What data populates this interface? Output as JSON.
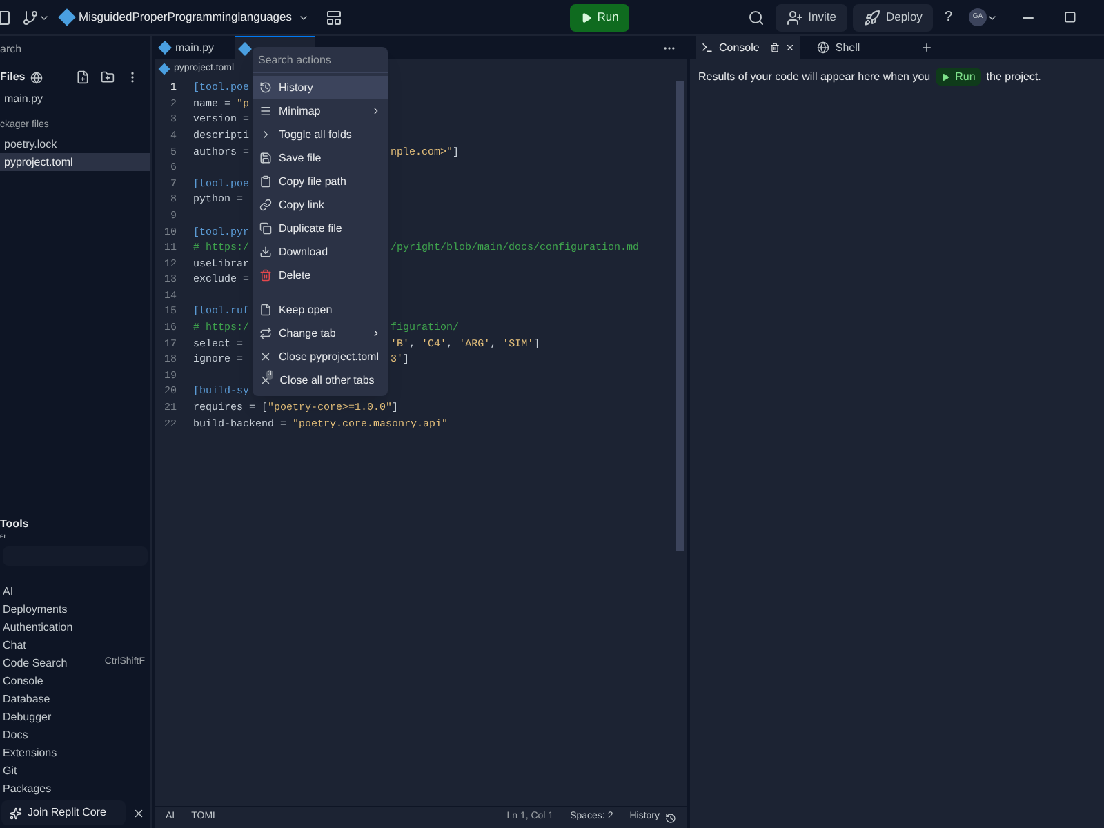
{
  "topbar": {
    "title": "MisguidedProperProgramminglanguages",
    "run": "Run",
    "invite": "Invite",
    "deploy": "Deploy",
    "help": "?",
    "avatar": "GA"
  },
  "sidebar": {
    "search": {
      "placeholder": "arch"
    },
    "files_title": "Files",
    "files": [
      {
        "label": "main.py",
        "kind": "file",
        "selected": false
      },
      {
        "label": "ckager files",
        "kind": "heading"
      },
      {
        "label": "poetry.lock",
        "kind": "file",
        "selected": false
      },
      {
        "label": "pyproject.toml",
        "kind": "file",
        "selected": true
      }
    ],
    "tools_title": "Tools",
    "tools_filter": "er",
    "tools": [
      {
        "label": "AI"
      },
      {
        "label": "Deployments"
      },
      {
        "label": "Authentication"
      },
      {
        "label": "Chat"
      },
      {
        "label": "Code Search",
        "shortcut": "CtrlShiftF"
      },
      {
        "label": "Console"
      },
      {
        "label": "Database"
      },
      {
        "label": "Debugger"
      },
      {
        "label": "Docs"
      },
      {
        "label": "Extensions"
      },
      {
        "label": "Git"
      },
      {
        "label": "Packages"
      }
    ],
    "join": "Join Replit Core"
  },
  "editor": {
    "tabs": [
      {
        "label": "main.py",
        "selected": false
      },
      {
        "selected": true
      }
    ],
    "breadcrumb": "pyproject.toml",
    "lines": [
      {
        "n": "1",
        "left": [
          {
            "text": "[tool.poe",
            "kind": "section"
          }
        ]
      },
      {
        "n": "2",
        "left": [
          {
            "text": "name = ",
            "kind": "plain"
          },
          {
            "text": "\"p",
            "kind": "string"
          }
        ]
      },
      {
        "n": "3",
        "left": [
          {
            "text": "version =",
            "kind": "plain"
          }
        ]
      },
      {
        "n": "4",
        "left": [
          {
            "text": "descripti",
            "kind": "plain"
          }
        ]
      },
      {
        "n": "5",
        "left": [
          {
            "text": "authors =",
            "kind": "plain"
          }
        ],
        "right": [
          {
            "text": "nple.com>\"",
            "kind": "string"
          },
          {
            "text": "]",
            "kind": "plain"
          }
        ]
      },
      {
        "n": "6"
      },
      {
        "n": "7",
        "left": [
          {
            "text": "[tool.poe",
            "kind": "section"
          }
        ]
      },
      {
        "n": "8",
        "left": [
          {
            "text": "python =",
            "kind": "plain"
          }
        ]
      },
      {
        "n": "9"
      },
      {
        "n": "10",
        "left": [
          {
            "text": "[tool.pyr",
            "kind": "section"
          }
        ]
      },
      {
        "n": "11",
        "left": [
          {
            "text": "# https:/",
            "kind": "comment"
          }
        ],
        "right": [
          {
            "text": "/pyright/blob/main/docs/configuration.md",
            "kind": "comment"
          }
        ]
      },
      {
        "n": "12",
        "left": [
          {
            "text": "useLibrar",
            "kind": "plain"
          }
        ]
      },
      {
        "n": "13",
        "left": [
          {
            "text": "exclude =",
            "kind": "plain"
          }
        ]
      },
      {
        "n": "14"
      },
      {
        "n": "15",
        "left": [
          {
            "text": "[tool.ruf",
            "kind": "section"
          }
        ]
      },
      {
        "n": "16",
        "left": [
          {
            "text": "# https:/",
            "kind": "comment"
          }
        ],
        "right": [
          {
            "text": "figuration/",
            "kind": "comment"
          }
        ]
      },
      {
        "n": "17",
        "left": [
          {
            "text": "select =",
            "kind": "plain"
          }
        ],
        "right": [
          {
            "text": "'B'",
            "kind": "string"
          },
          {
            "text": ", ",
            "kind": "plain"
          },
          {
            "text": "'C4'",
            "kind": "string"
          },
          {
            "text": ", ",
            "kind": "plain"
          },
          {
            "text": "'ARG'",
            "kind": "string"
          },
          {
            "text": ", ",
            "kind": "plain"
          },
          {
            "text": "'SIM'",
            "kind": "string"
          },
          {
            "text": "]",
            "kind": "plain"
          }
        ]
      },
      {
        "n": "18",
        "left": [
          {
            "text": "ignore =",
            "kind": "plain"
          }
        ],
        "right": [
          {
            "text": "3'",
            "kind": "string"
          },
          {
            "text": "]",
            "kind": "plain"
          }
        ]
      },
      {
        "n": "19"
      },
      {
        "n": "20",
        "left": [
          {
            "text": "[build-sy",
            "kind": "section"
          }
        ]
      },
      {
        "n": "21",
        "left": [
          {
            "text": "requires = [",
            "kind": "plain"
          },
          {
            "text": "\"poetry-core>=1.0.0\"",
            "kind": "string"
          },
          {
            "text": "]",
            "kind": "plain"
          }
        ]
      },
      {
        "n": "22",
        "left": [
          {
            "text": "build-backend = ",
            "kind": "plain"
          },
          {
            "text": "\"poetry.core.masonry.api\"",
            "kind": "string"
          }
        ]
      }
    ],
    "status": {
      "ai": "AI",
      "language": "TOML",
      "position": "Ln 1, Col 1",
      "spaces": "Spaces: 2",
      "history": "History"
    }
  },
  "menu": {
    "search": {
      "placeholder": "Search actions"
    },
    "groups": [
      [
        {
          "label": "History",
          "selected": true,
          "submenu": false,
          "danger": false
        },
        {
          "label": "Minimap",
          "selected": false,
          "submenu": true,
          "danger": false
        },
        {
          "label": "Toggle all folds",
          "selected": false,
          "submenu": false,
          "danger": false
        },
        {
          "label": "Save file",
          "selected": false,
          "submenu": false,
          "danger": false
        },
        {
          "label": "Copy file path",
          "selected": false,
          "submenu": false,
          "danger": false
        },
        {
          "label": "Copy link",
          "selected": false,
          "submenu": false,
          "danger": false
        },
        {
          "label": "Duplicate file",
          "selected": false,
          "submenu": false,
          "danger": false
        },
        {
          "label": "Download",
          "selected": false,
          "submenu": false,
          "danger": false
        },
        {
          "label": "Delete",
          "selected": false,
          "submenu": false,
          "danger": true
        }
      ],
      [
        {
          "label": "Keep open",
          "selected": false,
          "submenu": false,
          "danger": false
        },
        {
          "label": "Change tab",
          "selected": false,
          "submenu": true,
          "danger": false
        },
        {
          "label": "Close pyproject.toml",
          "selected": false,
          "submenu": false,
          "danger": false
        },
        {
          "label": "Close all other tabs",
          "selected": false,
          "submenu": false,
          "danger": false,
          "badge": "3"
        }
      ]
    ]
  },
  "console": {
    "tabs": [
      {
        "label": "Console",
        "selected": true
      },
      {
        "label": "Shell",
        "selected": false
      }
    ],
    "message_before": "Results of your code will appear here when you",
    "run": "Run",
    "message_after": "the project."
  }
}
